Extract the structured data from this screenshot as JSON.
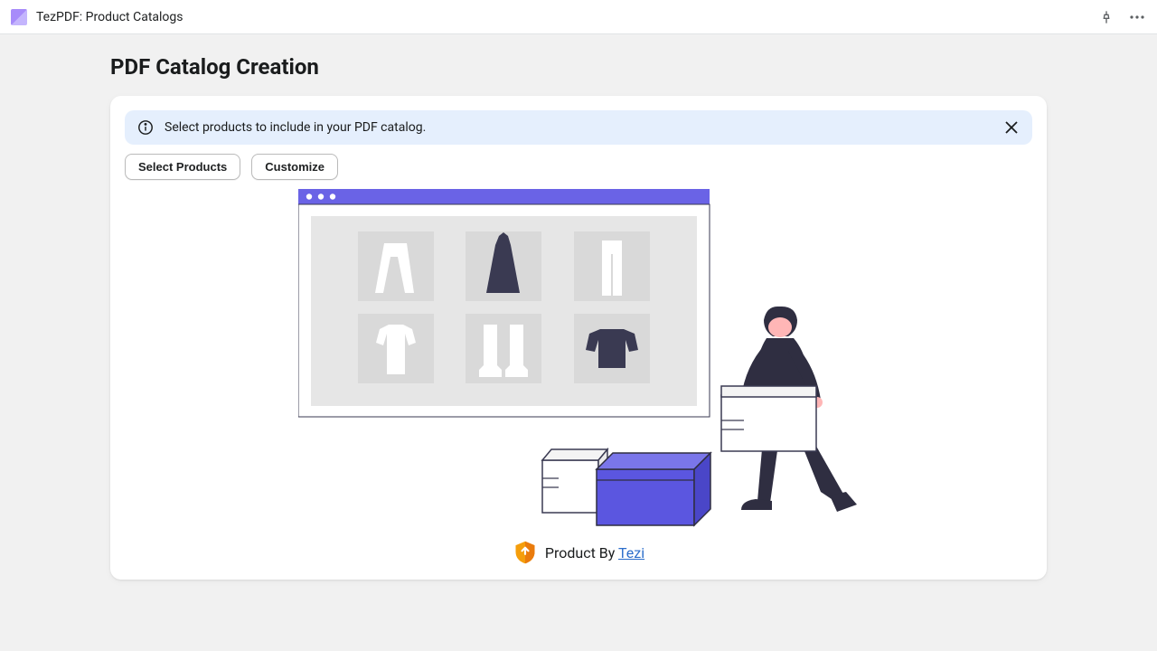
{
  "header": {
    "app_title": "TezPDF: Product Catalogs"
  },
  "page": {
    "title": "PDF Catalog Creation"
  },
  "banner": {
    "message": "Select products to include in your PDF catalog."
  },
  "actions": {
    "select_products": "Select Products",
    "customize": "Customize"
  },
  "credit": {
    "prefix": "Product By ",
    "link_text": "Tezi"
  }
}
